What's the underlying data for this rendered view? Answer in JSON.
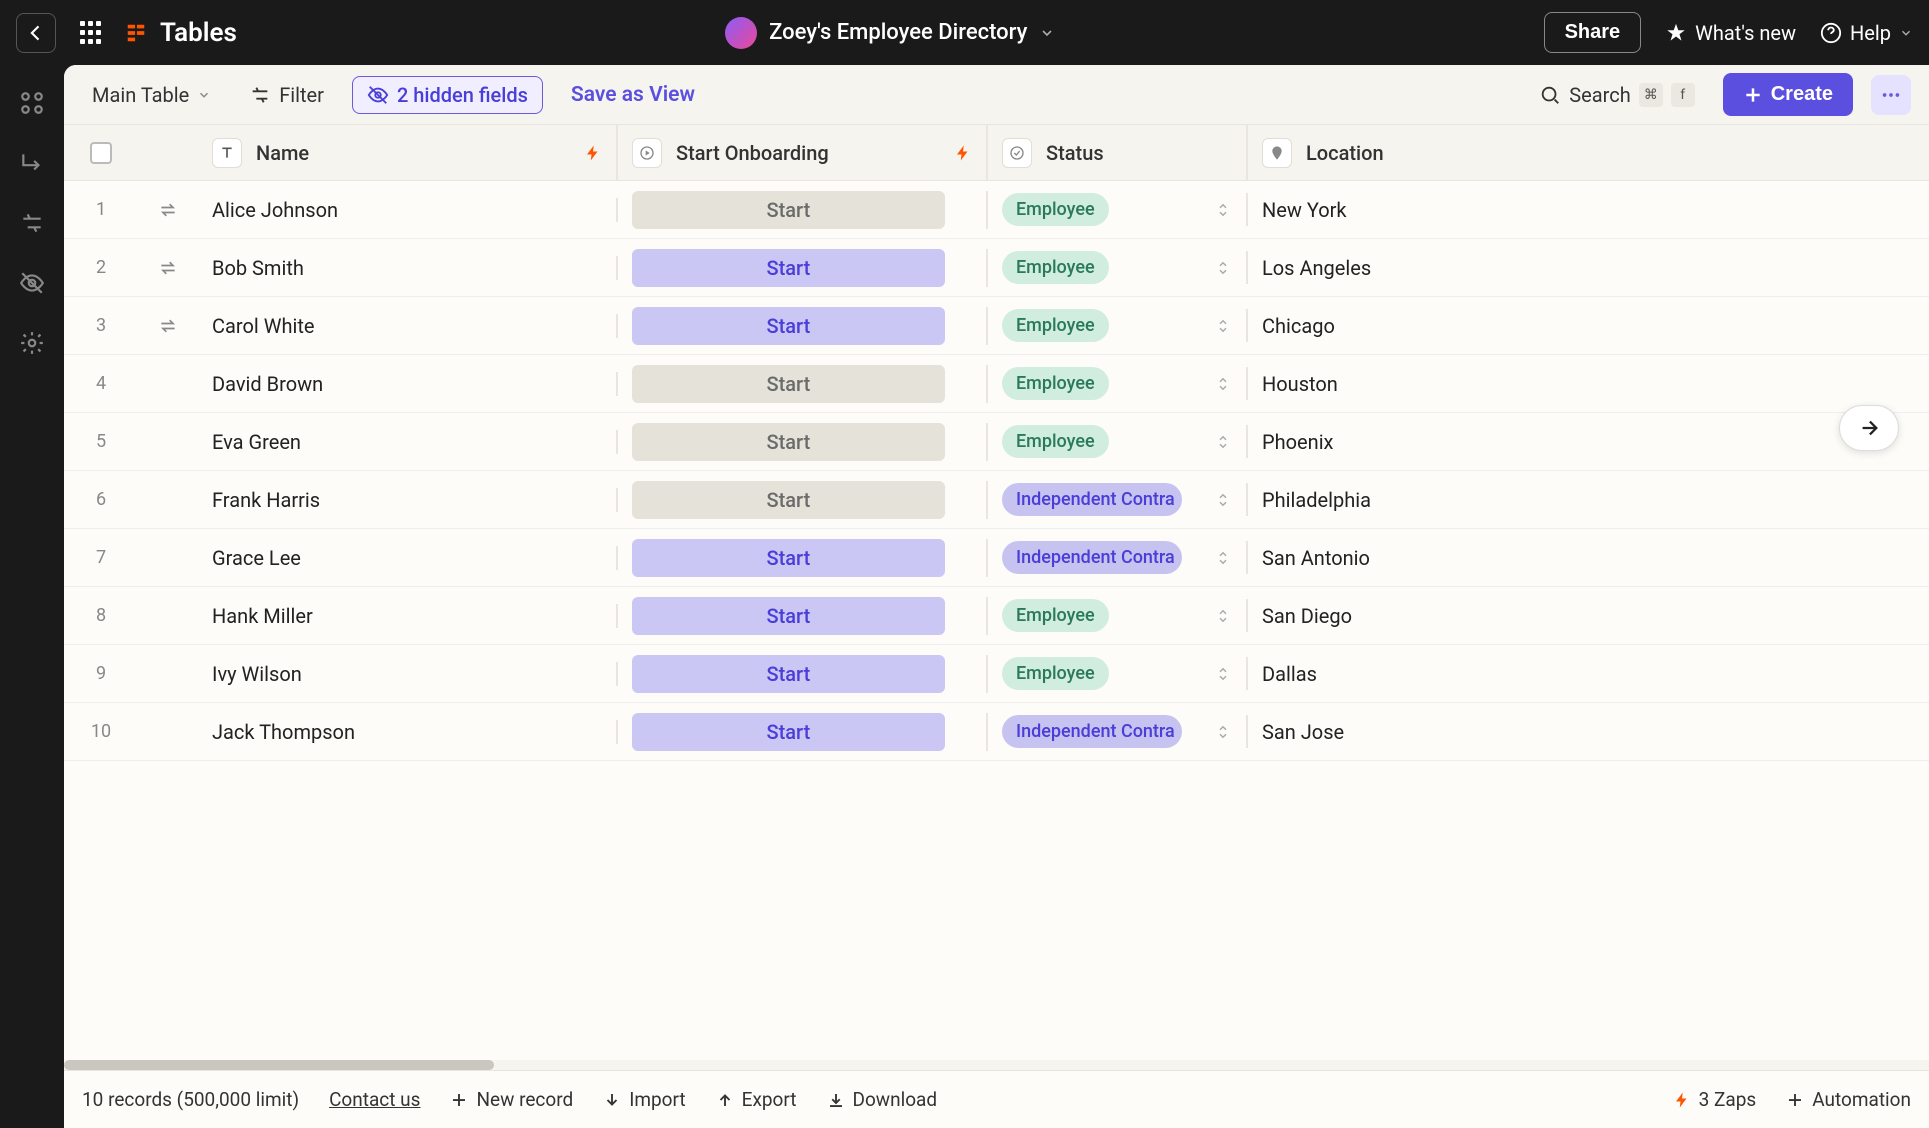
{
  "topbar": {
    "brand": "Tables",
    "doc_title": "Zoey's Employee Directory",
    "share": "Share",
    "whats_new": "What's new",
    "help": "Help"
  },
  "toolbar": {
    "main_table": "Main Table",
    "filter": "Filter",
    "hidden_fields": "2 hidden fields",
    "save_view": "Save as View",
    "search": "Search",
    "kbd1": "⌘",
    "kbd2": "f",
    "create": "Create"
  },
  "columns": {
    "name": "Name",
    "onboarding": "Start Onboarding",
    "status": "Status",
    "location": "Location"
  },
  "rows": [
    {
      "num": "1",
      "exch": true,
      "name": "Alice Johnson",
      "start_variant": "neutral",
      "start_label": "Start",
      "status": "Employee",
      "status_variant": "employee",
      "location": "New York"
    },
    {
      "num": "2",
      "exch": true,
      "name": "Bob Smith",
      "start_variant": "active",
      "start_label": "Start",
      "status": "Employee",
      "status_variant": "employee",
      "location": "Los Angeles"
    },
    {
      "num": "3",
      "exch": true,
      "name": "Carol White",
      "start_variant": "active",
      "start_label": "Start",
      "status": "Employee",
      "status_variant": "employee",
      "location": "Chicago"
    },
    {
      "num": "4",
      "exch": false,
      "name": "David Brown",
      "start_variant": "neutral",
      "start_label": "Start",
      "status": "Employee",
      "status_variant": "employee",
      "location": "Houston"
    },
    {
      "num": "5",
      "exch": false,
      "name": "Eva Green",
      "start_variant": "neutral",
      "start_label": "Start",
      "status": "Employee",
      "status_variant": "employee",
      "location": "Phoenix"
    },
    {
      "num": "6",
      "exch": false,
      "name": "Frank Harris",
      "start_variant": "neutral",
      "start_label": "Start",
      "status": "Independent Contra",
      "status_variant": "contract",
      "location": "Philadelphia"
    },
    {
      "num": "7",
      "exch": false,
      "name": "Grace Lee",
      "start_variant": "active",
      "start_label": "Start",
      "status": "Independent Contra",
      "status_variant": "contract",
      "location": "San Antonio"
    },
    {
      "num": "8",
      "exch": false,
      "name": "Hank Miller",
      "start_variant": "active",
      "start_label": "Start",
      "status": "Employee",
      "status_variant": "employee",
      "location": "San Diego"
    },
    {
      "num": "9",
      "exch": false,
      "name": "Ivy Wilson",
      "start_variant": "active",
      "start_label": "Start",
      "status": "Employee",
      "status_variant": "employee",
      "location": "Dallas"
    },
    {
      "num": "10",
      "exch": false,
      "name": "Jack Thompson",
      "start_variant": "active",
      "start_label": "Start",
      "status": "Independent Contra",
      "status_variant": "contract",
      "location": "San Jose"
    }
  ],
  "bottombar": {
    "records": "10 records (500,000 limit)",
    "contact": "Contact us",
    "new_record": "New record",
    "import": "Import",
    "export": "Export",
    "download": "Download",
    "zaps": "3 Zaps",
    "automation": "Automation"
  }
}
